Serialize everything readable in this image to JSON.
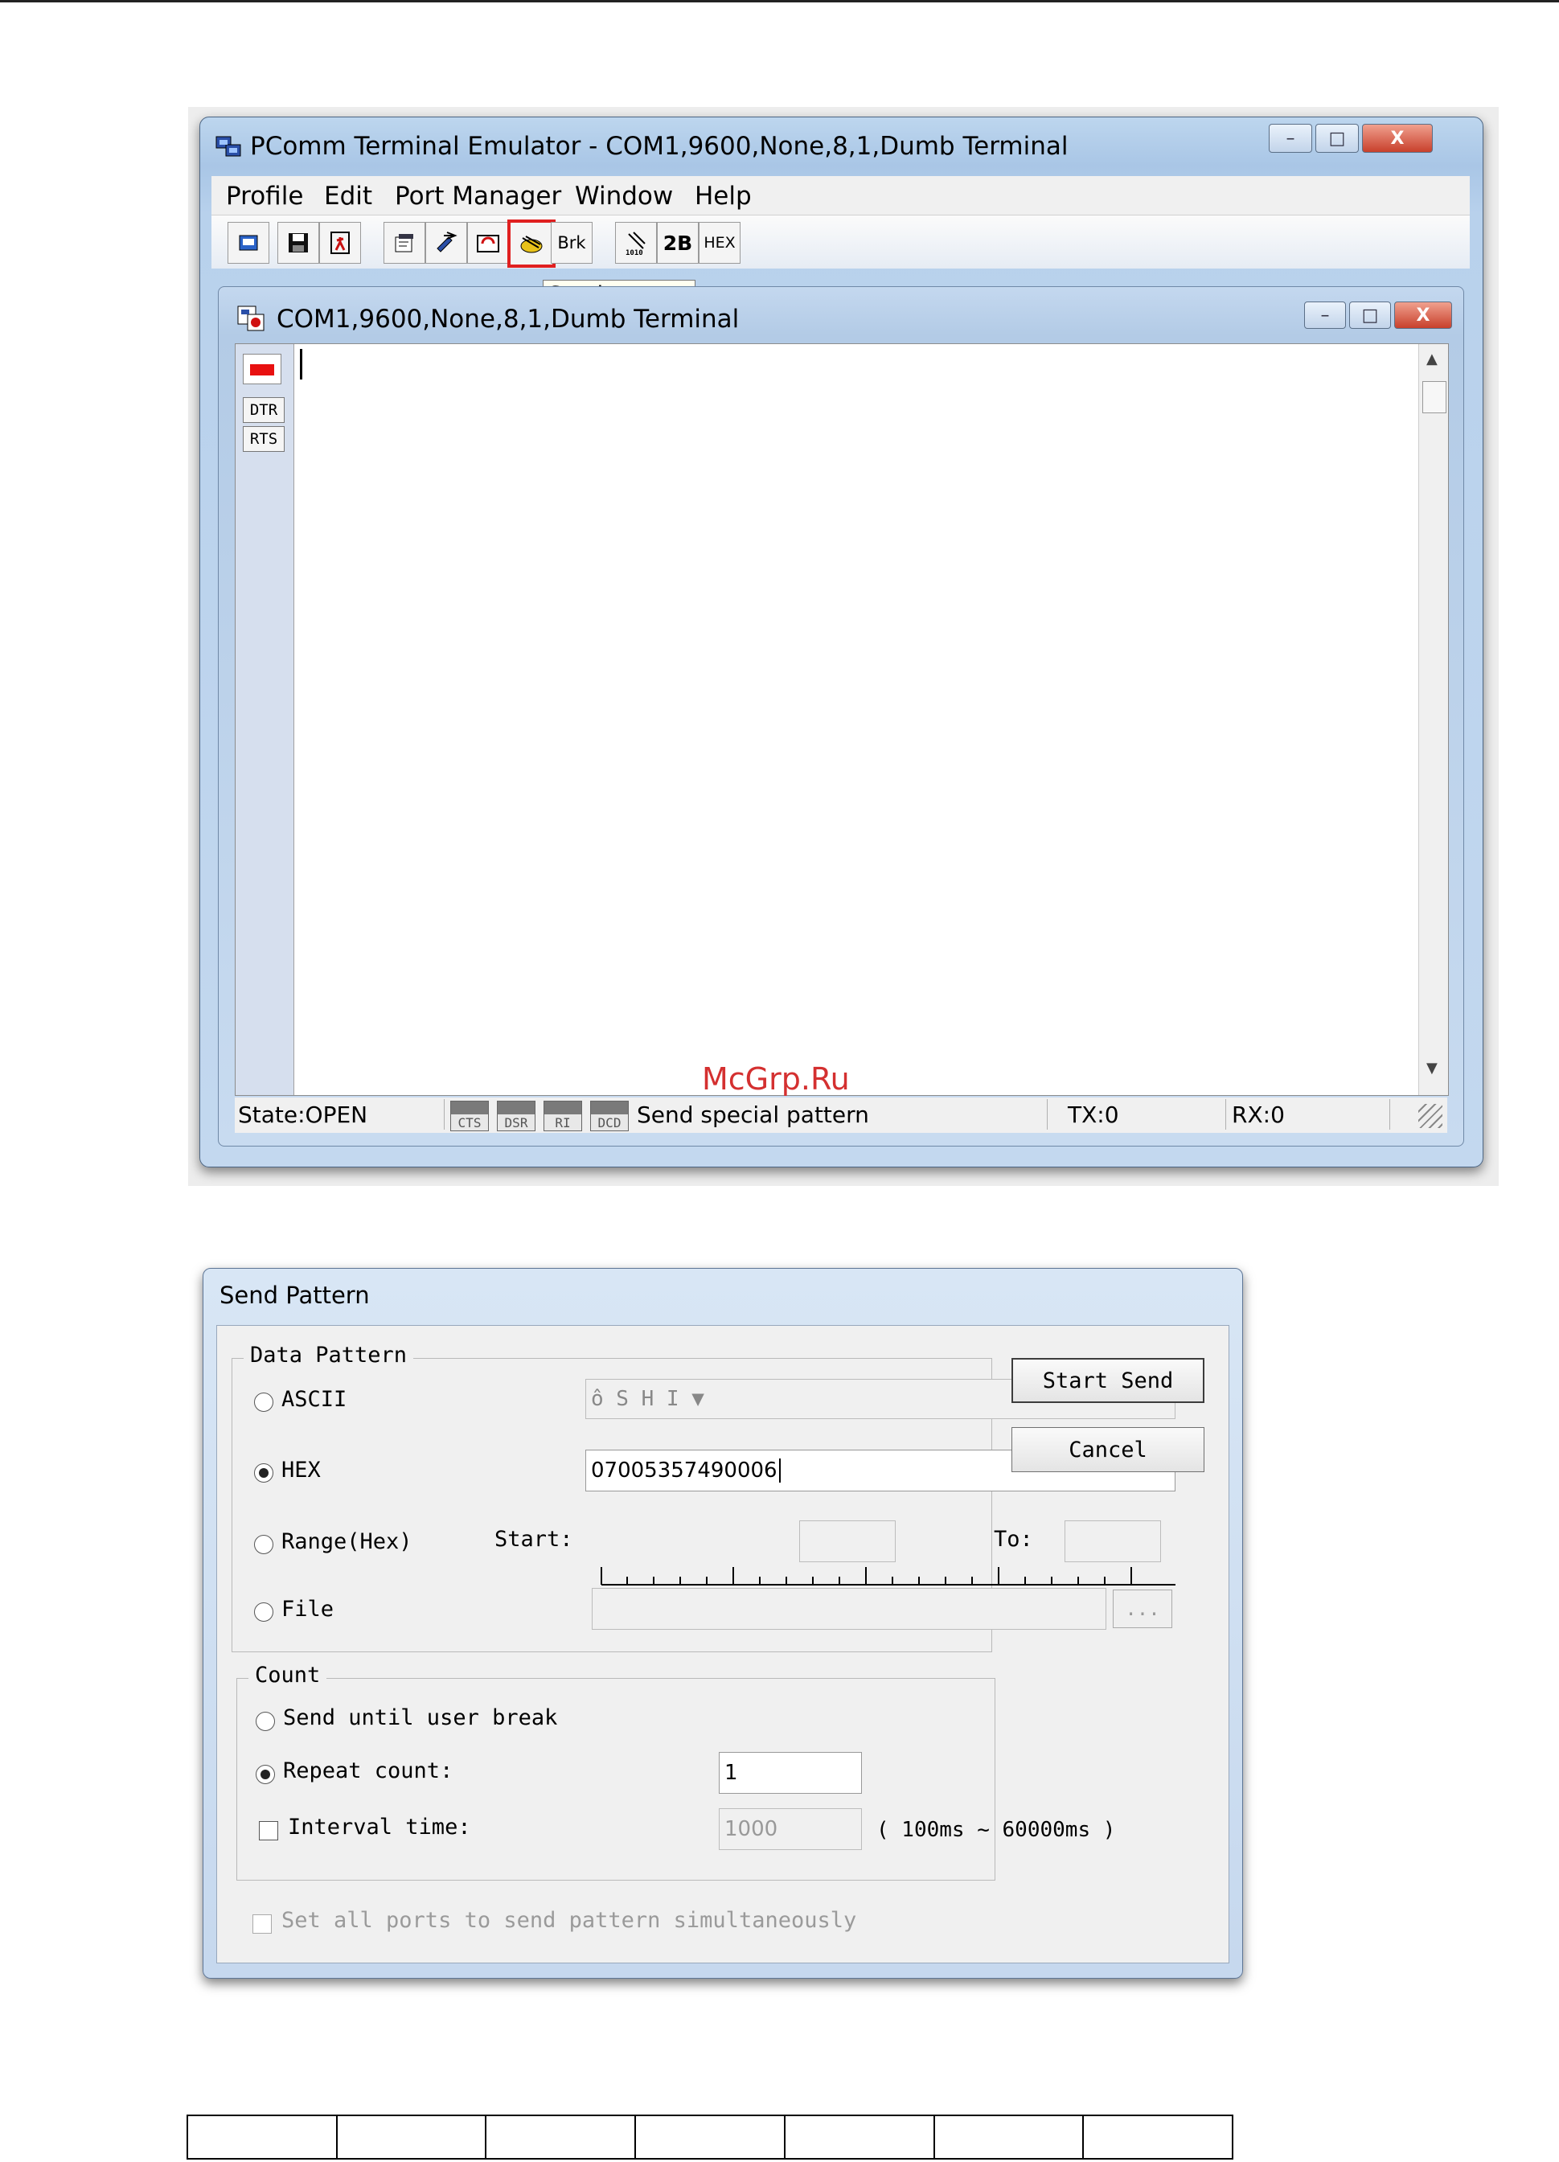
{
  "pcomm": {
    "title": "PComm Terminal Emulator - COM1,9600,None,8,1,Dumb Terminal",
    "caption_buttons": {
      "minimize": "–",
      "maximize": "□",
      "close": "X"
    },
    "menu": [
      "Profile",
      "Edit",
      "Port Manager",
      "Window",
      "Help"
    ],
    "toolbar": {
      "break_label": "Brk",
      "twob_label": "2B",
      "hex_label": "HEX",
      "tooltip": "Send pattern"
    },
    "child": {
      "title": "COM1,9600,None,8,1,Dumb Terminal",
      "dtr": "DTR",
      "rts": "RTS"
    },
    "status": {
      "state": "State:OPEN",
      "signals": [
        "CTS",
        "DSR",
        "RI",
        "DCD"
      ],
      "message": "Send special pattern",
      "tx": "TX:0",
      "rx": "RX:0"
    },
    "accent": "#e02020"
  },
  "watermark": "McGrp.Ru",
  "dialog": {
    "title": "Send Pattern",
    "data_pattern": {
      "label": "Data Pattern",
      "ascii_label": "ASCII",
      "ascii_value": "ô  S H I  ▼",
      "hex_label": "HEX",
      "hex_value": "07005357490006",
      "range_label": "Range(Hex)",
      "start_label": "Start:",
      "to_label": "To:",
      "file_label": "File",
      "browse_label": "..."
    },
    "count": {
      "label": "Count",
      "until_break_label": "Send until user break",
      "repeat_label": "Repeat count:",
      "repeat_value": "1",
      "interval_label": "Interval time:",
      "interval_value": "1000",
      "interval_range": "( 100ms ~ 60000ms )"
    },
    "all_ports_label": "Set all ports to send pattern simultaneously",
    "start_send_label": "Start Send",
    "cancel_label": "Cancel",
    "selected_mode": "HEX",
    "selected_count": "Repeat count"
  }
}
